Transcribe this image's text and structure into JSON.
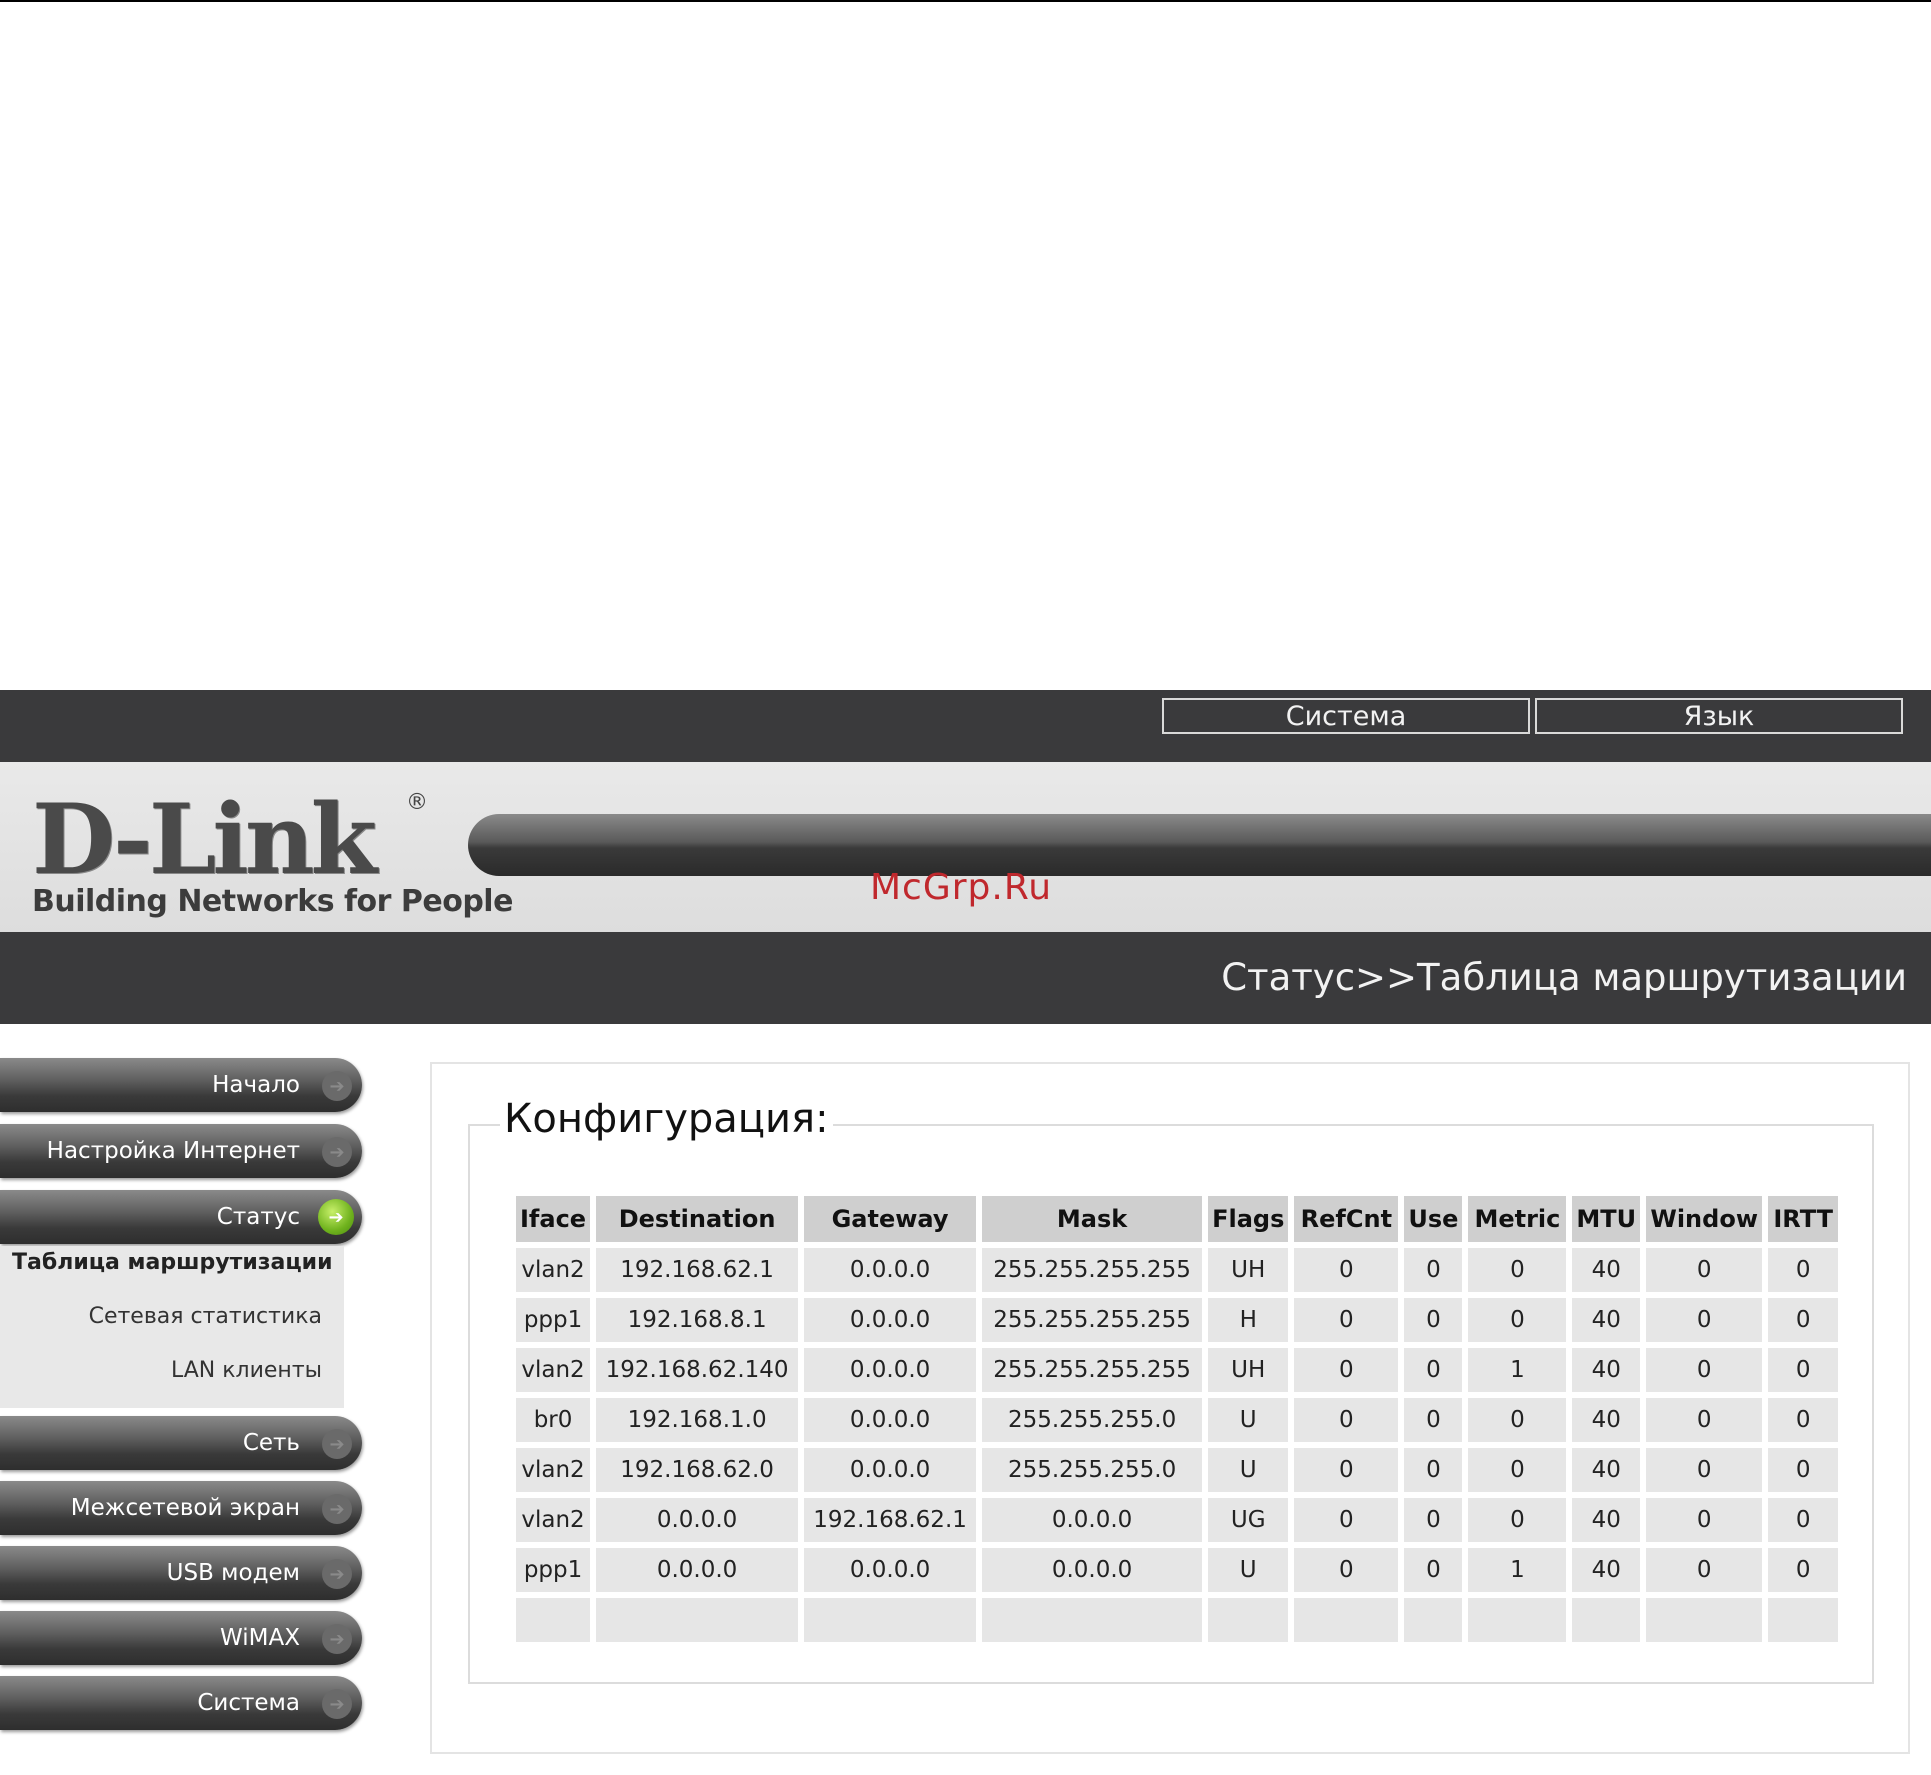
{
  "topbar": {
    "buttons": [
      "Система",
      "Язык"
    ]
  },
  "logo": {
    "brand": "D-Link",
    "registered": "®",
    "tagline": "Building Networks for People"
  },
  "watermark": "McGrp.Ru",
  "breadcrumb": "Статус>>Таблица маршрутизации",
  "nav": {
    "items": [
      {
        "label": "Начало"
      },
      {
        "label": "Настройка Интернет"
      },
      {
        "label": "Статус"
      },
      {
        "label": "Сеть"
      },
      {
        "label": "Межсетевой экран"
      },
      {
        "label": "USB модем"
      },
      {
        "label": "WiMAX"
      },
      {
        "label": "Система"
      }
    ],
    "sub": [
      {
        "label": "Таблица маршрутизации"
      },
      {
        "label": "Сетевая статистика"
      },
      {
        "label": "LAN клиенты"
      }
    ]
  },
  "section_title": "Конфигурация:",
  "table": {
    "columns": [
      "Iface",
      "Destination",
      "Gateway",
      "Mask",
      "Flags",
      "RefCnt",
      "Use",
      "Metric",
      "MTU",
      "Window",
      "IRTT"
    ],
    "rows": [
      [
        "vlan2",
        "192.168.62.1",
        "0.0.0.0",
        "255.255.255.255",
        "UH",
        "0",
        "0",
        "0",
        "40",
        "0",
        "0"
      ],
      [
        "ppp1",
        "192.168.8.1",
        "0.0.0.0",
        "255.255.255.255",
        "H",
        "0",
        "0",
        "0",
        "40",
        "0",
        "0"
      ],
      [
        "vlan2",
        "192.168.62.140",
        "0.0.0.0",
        "255.255.255.255",
        "UH",
        "0",
        "0",
        "1",
        "40",
        "0",
        "0"
      ],
      [
        "br0",
        "192.168.1.0",
        "0.0.0.0",
        "255.255.255.0",
        "U",
        "0",
        "0",
        "0",
        "40",
        "0",
        "0"
      ],
      [
        "vlan2",
        "192.168.62.0",
        "0.0.0.0",
        "255.255.255.0",
        "U",
        "0",
        "0",
        "0",
        "40",
        "0",
        "0"
      ],
      [
        "vlan2",
        "0.0.0.0",
        "192.168.62.1",
        "0.0.0.0",
        "UG",
        "0",
        "0",
        "0",
        "40",
        "0",
        "0"
      ],
      [
        "ppp1",
        "0.0.0.0",
        "0.0.0.0",
        "0.0.0.0",
        "U",
        "0",
        "0",
        "1",
        "40",
        "0",
        "0"
      ],
      [
        "",
        "",
        "",
        "",
        "",
        "",
        "",
        "",
        "",
        "",
        ""
      ]
    ]
  },
  "colors": {
    "dark_bar": "#3a3a3c",
    "logo_band": "#e4e4e4",
    "active_icon": "#6fb21d",
    "watermark": "#c0282d"
  },
  "icons": {
    "nav_arrow": "arrow-right-icon"
  }
}
